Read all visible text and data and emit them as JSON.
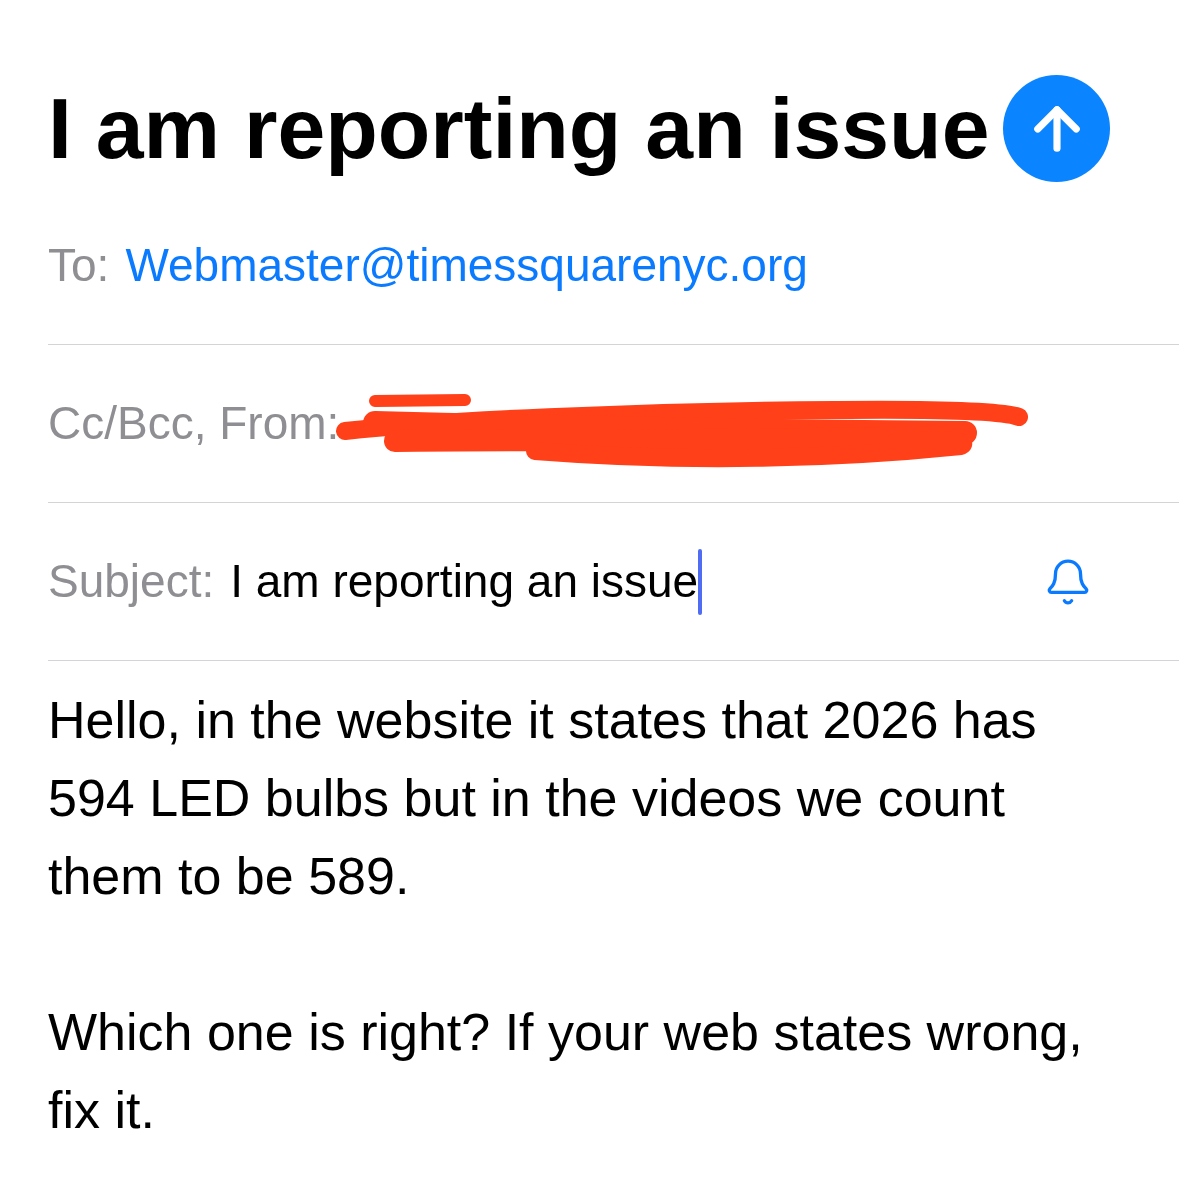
{
  "title": "I am reporting an issue",
  "send_button": {
    "disabled": false
  },
  "fields": [
    {
      "kind": "recipient",
      "label": "To:",
      "value": "Webmaster@timessquarenyc.org"
    },
    {
      "kind": "sender",
      "label": "Cc/Bcc, From:",
      "redacted": true
    },
    {
      "kind": "subject",
      "label": "Subject:",
      "value": "I am reporting an issue",
      "focused": true
    }
  ],
  "body": [
    "Hello, in the website it states that 2026 has 594 LED bulbs but in the videos we count them to be 589.",
    "Which one is right? If your web states wrong, fix it."
  ]
}
